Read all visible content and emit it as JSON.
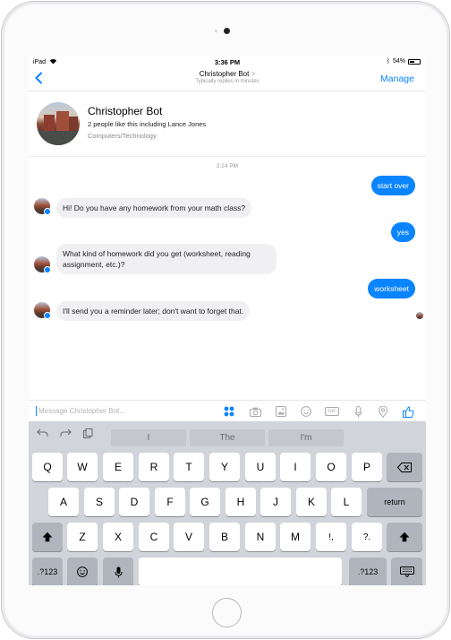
{
  "status": {
    "carrier": "iPad",
    "wifi": "wifi-icon",
    "time": "3:36 PM",
    "battery": "54%",
    "battery_level": 0.54
  },
  "navbar": {
    "back": "chevron-left-icon",
    "title": "Christopher Bot",
    "title_chevron": ">",
    "subtitle": "Typically replies in minutes",
    "manage": "Manage"
  },
  "profile": {
    "name": "Christopher Bot",
    "likes": "2 people like this including Lance Jones",
    "category": "Computers/Technology"
  },
  "chat": {
    "timestamp": "3:24 PM",
    "messages": [
      {
        "from": "user",
        "text": "start over"
      },
      {
        "from": "bot",
        "text": "Hi! Do you have any homework from your math class?"
      },
      {
        "from": "user",
        "text": "yes"
      },
      {
        "from": "bot",
        "text": "What kind of homework did you get (worksheet, reading assignment, etc.)?"
      },
      {
        "from": "user",
        "text": "worksheet"
      },
      {
        "from": "bot",
        "text": "I'll send you a reminder later; don't want to forget that."
      }
    ]
  },
  "composer": {
    "placeholder": "Message Christopher Bot...",
    "tools": [
      "apps-icon",
      "camera-icon",
      "photo-icon",
      "emoji-icon",
      "gif-icon",
      "microphone-icon",
      "location-icon",
      "thumbs-up-icon"
    ],
    "gif_label": "GIF"
  },
  "keyboard": {
    "suggestions": [
      "I",
      "The",
      "I'm"
    ],
    "row1": [
      "Q",
      "W",
      "E",
      "R",
      "T",
      "Y",
      "U",
      "I",
      "O",
      "P"
    ],
    "row2": [
      "A",
      "S",
      "D",
      "F",
      "G",
      "H",
      "J",
      "K",
      "L"
    ],
    "row3": [
      "Z",
      "X",
      "C",
      "V",
      "B",
      "N",
      "M",
      "!,",
      "?."
    ],
    "return_label": "return",
    "numbers_label": ".?123",
    "accent": "#0a84ff"
  }
}
